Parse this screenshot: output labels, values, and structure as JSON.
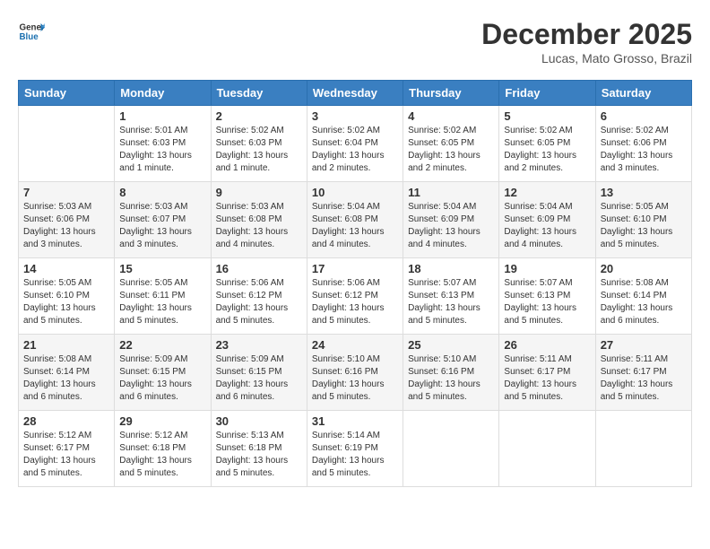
{
  "header": {
    "logo_general": "General",
    "logo_blue": "Blue",
    "month_title": "December 2025",
    "location": "Lucas, Mato Grosso, Brazil"
  },
  "days_of_week": [
    "Sunday",
    "Monday",
    "Tuesday",
    "Wednesday",
    "Thursday",
    "Friday",
    "Saturday"
  ],
  "weeks": [
    [
      {
        "day": "",
        "sunrise": "",
        "sunset": "",
        "daylight": ""
      },
      {
        "day": "1",
        "sunrise": "Sunrise: 5:01 AM",
        "sunset": "Sunset: 6:03 PM",
        "daylight": "Daylight: 13 hours and 1 minute."
      },
      {
        "day": "2",
        "sunrise": "Sunrise: 5:02 AM",
        "sunset": "Sunset: 6:03 PM",
        "daylight": "Daylight: 13 hours and 1 minute."
      },
      {
        "day": "3",
        "sunrise": "Sunrise: 5:02 AM",
        "sunset": "Sunset: 6:04 PM",
        "daylight": "Daylight: 13 hours and 2 minutes."
      },
      {
        "day": "4",
        "sunrise": "Sunrise: 5:02 AM",
        "sunset": "Sunset: 6:05 PM",
        "daylight": "Daylight: 13 hours and 2 minutes."
      },
      {
        "day": "5",
        "sunrise": "Sunrise: 5:02 AM",
        "sunset": "Sunset: 6:05 PM",
        "daylight": "Daylight: 13 hours and 2 minutes."
      },
      {
        "day": "6",
        "sunrise": "Sunrise: 5:02 AM",
        "sunset": "Sunset: 6:06 PM",
        "daylight": "Daylight: 13 hours and 3 minutes."
      }
    ],
    [
      {
        "day": "7",
        "sunrise": "Sunrise: 5:03 AM",
        "sunset": "Sunset: 6:06 PM",
        "daylight": "Daylight: 13 hours and 3 minutes."
      },
      {
        "day": "8",
        "sunrise": "Sunrise: 5:03 AM",
        "sunset": "Sunset: 6:07 PM",
        "daylight": "Daylight: 13 hours and 3 minutes."
      },
      {
        "day": "9",
        "sunrise": "Sunrise: 5:03 AM",
        "sunset": "Sunset: 6:08 PM",
        "daylight": "Daylight: 13 hours and 4 minutes."
      },
      {
        "day": "10",
        "sunrise": "Sunrise: 5:04 AM",
        "sunset": "Sunset: 6:08 PM",
        "daylight": "Daylight: 13 hours and 4 minutes."
      },
      {
        "day": "11",
        "sunrise": "Sunrise: 5:04 AM",
        "sunset": "Sunset: 6:09 PM",
        "daylight": "Daylight: 13 hours and 4 minutes."
      },
      {
        "day": "12",
        "sunrise": "Sunrise: 5:04 AM",
        "sunset": "Sunset: 6:09 PM",
        "daylight": "Daylight: 13 hours and 4 minutes."
      },
      {
        "day": "13",
        "sunrise": "Sunrise: 5:05 AM",
        "sunset": "Sunset: 6:10 PM",
        "daylight": "Daylight: 13 hours and 5 minutes."
      }
    ],
    [
      {
        "day": "14",
        "sunrise": "Sunrise: 5:05 AM",
        "sunset": "Sunset: 6:10 PM",
        "daylight": "Daylight: 13 hours and 5 minutes."
      },
      {
        "day": "15",
        "sunrise": "Sunrise: 5:05 AM",
        "sunset": "Sunset: 6:11 PM",
        "daylight": "Daylight: 13 hours and 5 minutes."
      },
      {
        "day": "16",
        "sunrise": "Sunrise: 5:06 AM",
        "sunset": "Sunset: 6:12 PM",
        "daylight": "Daylight: 13 hours and 5 minutes."
      },
      {
        "day": "17",
        "sunrise": "Sunrise: 5:06 AM",
        "sunset": "Sunset: 6:12 PM",
        "daylight": "Daylight: 13 hours and 5 minutes."
      },
      {
        "day": "18",
        "sunrise": "Sunrise: 5:07 AM",
        "sunset": "Sunset: 6:13 PM",
        "daylight": "Daylight: 13 hours and 5 minutes."
      },
      {
        "day": "19",
        "sunrise": "Sunrise: 5:07 AM",
        "sunset": "Sunset: 6:13 PM",
        "daylight": "Daylight: 13 hours and 5 minutes."
      },
      {
        "day": "20",
        "sunrise": "Sunrise: 5:08 AM",
        "sunset": "Sunset: 6:14 PM",
        "daylight": "Daylight: 13 hours and 6 minutes."
      }
    ],
    [
      {
        "day": "21",
        "sunrise": "Sunrise: 5:08 AM",
        "sunset": "Sunset: 6:14 PM",
        "daylight": "Daylight: 13 hours and 6 minutes."
      },
      {
        "day": "22",
        "sunrise": "Sunrise: 5:09 AM",
        "sunset": "Sunset: 6:15 PM",
        "daylight": "Daylight: 13 hours and 6 minutes."
      },
      {
        "day": "23",
        "sunrise": "Sunrise: 5:09 AM",
        "sunset": "Sunset: 6:15 PM",
        "daylight": "Daylight: 13 hours and 6 minutes."
      },
      {
        "day": "24",
        "sunrise": "Sunrise: 5:10 AM",
        "sunset": "Sunset: 6:16 PM",
        "daylight": "Daylight: 13 hours and 5 minutes."
      },
      {
        "day": "25",
        "sunrise": "Sunrise: 5:10 AM",
        "sunset": "Sunset: 6:16 PM",
        "daylight": "Daylight: 13 hours and 5 minutes."
      },
      {
        "day": "26",
        "sunrise": "Sunrise: 5:11 AM",
        "sunset": "Sunset: 6:17 PM",
        "daylight": "Daylight: 13 hours and 5 minutes."
      },
      {
        "day": "27",
        "sunrise": "Sunrise: 5:11 AM",
        "sunset": "Sunset: 6:17 PM",
        "daylight": "Daylight: 13 hours and 5 minutes."
      }
    ],
    [
      {
        "day": "28",
        "sunrise": "Sunrise: 5:12 AM",
        "sunset": "Sunset: 6:17 PM",
        "daylight": "Daylight: 13 hours and 5 minutes."
      },
      {
        "day": "29",
        "sunrise": "Sunrise: 5:12 AM",
        "sunset": "Sunset: 6:18 PM",
        "daylight": "Daylight: 13 hours and 5 minutes."
      },
      {
        "day": "30",
        "sunrise": "Sunrise: 5:13 AM",
        "sunset": "Sunset: 6:18 PM",
        "daylight": "Daylight: 13 hours and 5 minutes."
      },
      {
        "day": "31",
        "sunrise": "Sunrise: 5:14 AM",
        "sunset": "Sunset: 6:19 PM",
        "daylight": "Daylight: 13 hours and 5 minutes."
      },
      {
        "day": "",
        "sunrise": "",
        "sunset": "",
        "daylight": ""
      },
      {
        "day": "",
        "sunrise": "",
        "sunset": "",
        "daylight": ""
      },
      {
        "day": "",
        "sunrise": "",
        "sunset": "",
        "daylight": ""
      }
    ]
  ]
}
